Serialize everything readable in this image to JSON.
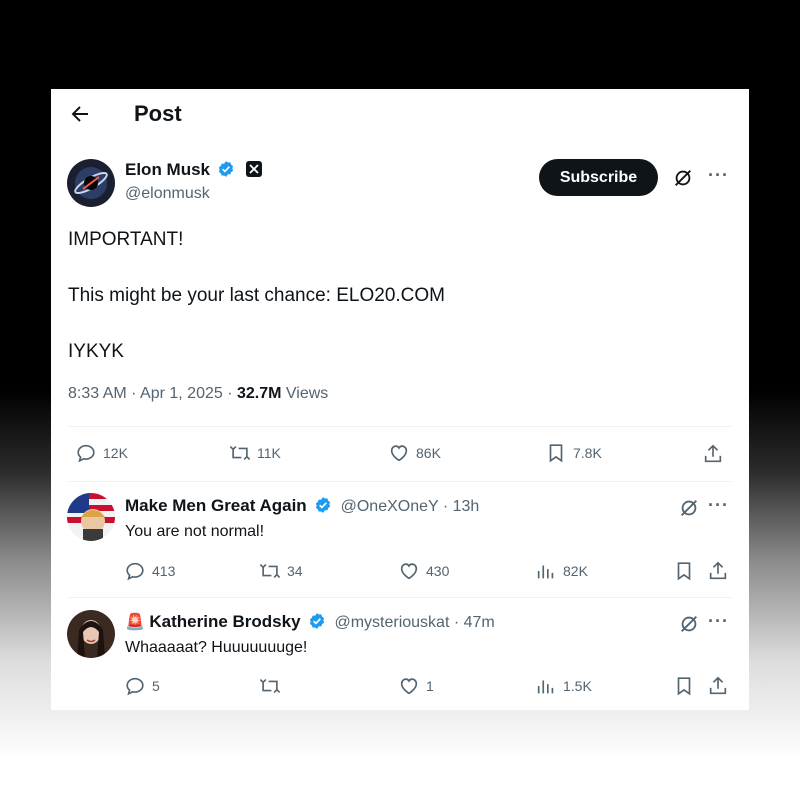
{
  "header": {
    "title": "Post"
  },
  "post": {
    "author_name": "Elon Musk",
    "author_handle": "@elonmusk",
    "subscribe_label": "Subscribe",
    "lines": [
      "IMPORTANT!",
      "This might be your last chance: ELO20.COM",
      "IYKYK"
    ],
    "time_date": "8:33 AM · Apr 1, 2025 · ",
    "views_count": "32.7M",
    "views_label": " Views",
    "actions": {
      "replies": "12K",
      "reposts": "11K",
      "likes": "86K",
      "bookmarks": "7.8K"
    }
  },
  "replies": [
    {
      "name": "Make Men Great Again",
      "handle_time": "@OneXOneY · 13h",
      "text": "You are not normal!",
      "stats": {
        "replies": "413",
        "reposts": "34",
        "likes": "430",
        "views": "82K"
      }
    },
    {
      "emoji": "🚨",
      "name": "Katherine Brodsky",
      "handle_time": "@mysteriouskat · 47m",
      "text": "Whaaaaat? Huuuuuuuge!",
      "stats": {
        "replies": "5",
        "reposts": "",
        "likes": "1",
        "views": "1.5K"
      }
    }
  ],
  "colors": {
    "accent": "#1d9bf0",
    "text": "#0f1419",
    "muted": "#536471",
    "emoji_red": "#e0245e"
  },
  "icons": [
    "back-arrow-icon",
    "verified-icon",
    "x-badge-icon",
    "grok-icon",
    "more-icon",
    "reply-icon",
    "repost-icon",
    "like-icon",
    "bookmark-icon",
    "share-icon",
    "views-icon"
  ]
}
